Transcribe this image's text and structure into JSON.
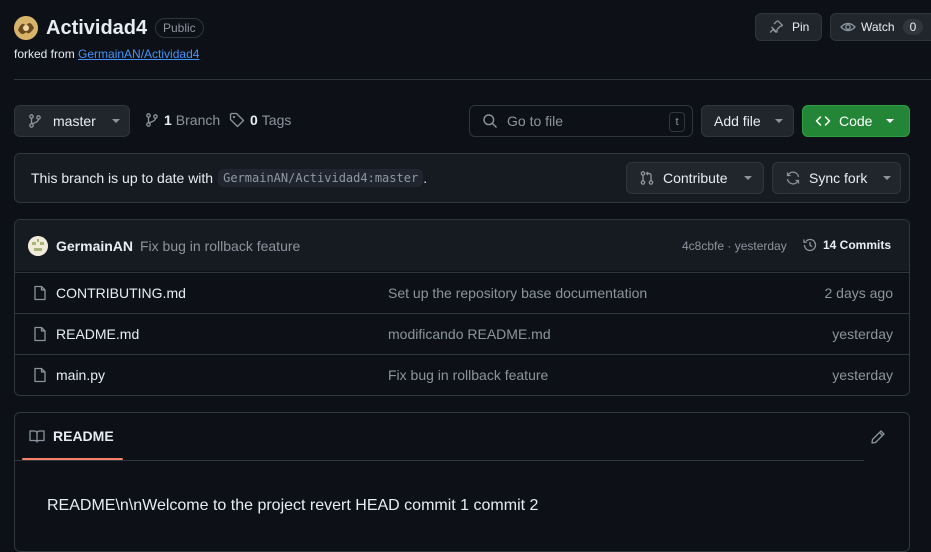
{
  "repo": {
    "name": "Actividad4",
    "visibility": "Public",
    "forked_prefix": "forked from",
    "forked_from": "GermainAN/Actividad4"
  },
  "header_actions": {
    "pin_label": "Pin",
    "watch_label": "Watch",
    "watch_count": "0"
  },
  "toolbar": {
    "branch_name": "master",
    "branch_count": "1",
    "branch_label": "Branch",
    "tag_count": "0",
    "tag_label": "Tags",
    "goto_placeholder": "Go to file",
    "goto_shortcut": "t",
    "add_file_label": "Add file",
    "code_label": "Code"
  },
  "sync_bar": {
    "text": "This branch is up to date with",
    "ref": "GermainAN/Actividad4:master",
    "period": ".",
    "contribute_label": "Contribute",
    "sync_label": "Sync fork"
  },
  "latest_commit": {
    "author": "GermainAN",
    "message": "Fix bug in rollback feature",
    "hash_time": "4c8cbfe · yesterday",
    "commits_label": "14 Commits"
  },
  "files": [
    {
      "name": "CONTRIBUTING.md",
      "message": "Set up the repository base documentation",
      "date": "2 days ago"
    },
    {
      "name": "README.md",
      "message": "modificando README.md",
      "date": "yesterday"
    },
    {
      "name": "main.py",
      "message": "Fix bug in rollback feature",
      "date": "yesterday"
    }
  ],
  "readme": {
    "tab_label": "README",
    "content": "README\\n\\nWelcome to the project revert HEAD commit 1 commit 2"
  },
  "colors": {
    "background": "#0d1117",
    "border": "#30363d",
    "button_bg": "#21262d",
    "code_button": "#238636",
    "link": "#4493f8",
    "tab_underline": "#f78166"
  }
}
